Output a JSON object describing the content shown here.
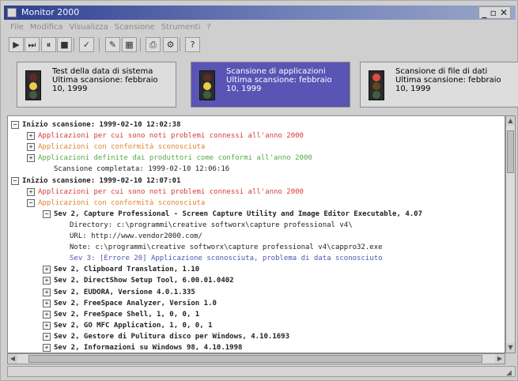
{
  "app": {
    "title": "Monitor 2000",
    "window_controls": "_|&#x2573;|x"
  },
  "menus": [
    "File",
    "Modifica",
    "Visualizza",
    "Scansione",
    "Strumenti",
    "?"
  ],
  "toolbar": {
    "buttons": [
      {
        "name": "play",
        "glyph": "▶"
      },
      {
        "name": "next",
        "glyph": "⏭"
      },
      {
        "name": "pause",
        "glyph": "⏸"
      },
      {
        "name": "stop",
        "glyph": "■"
      },
      {
        "name": "options",
        "glyph": "✓"
      },
      {
        "name": "edit",
        "glyph": "✎"
      },
      {
        "name": "report",
        "glyph": "▦"
      },
      {
        "name": "print",
        "glyph": "⎙"
      },
      {
        "name": "tools",
        "glyph": "⚙"
      },
      {
        "name": "help",
        "glyph": "?"
      }
    ]
  },
  "cards": [
    {
      "title": "Test della data di sistema",
      "line2": "Ultima scansione: febbraio",
      "line3": "10, 1999",
      "light": "amber"
    },
    {
      "title": "Scansione di applicazioni",
      "line2": "Ultima scansione: febbraio",
      "line3": "10, 1999",
      "light": "amber"
    },
    {
      "title": "Scansione di file di dati",
      "line2": "Ultima scansione: febbraio",
      "line3": "10, 1999",
      "light": "red"
    }
  ],
  "log": [
    {
      "indent": 0,
      "toggle": "−",
      "text": "Inizio scansione: 1999-02-10  12:02:38",
      "style": "bold"
    },
    {
      "indent": 1,
      "toggle": "+",
      "text": "Applicazioni per cui sono noti problemi connessi all'anno 2000",
      "style": "red"
    },
    {
      "indent": 1,
      "toggle": "+",
      "text": "Applicazioni con conformità sconosciuta",
      "style": "orange"
    },
    {
      "indent": 1,
      "toggle": "+",
      "text": "Applicazioni definite dai produttori come conformi all'anno 2000",
      "style": "green"
    },
    {
      "indent": 2,
      "toggle": "",
      "text": "Scansione completata: 1999-02-10  12:06:16",
      "style": "normal"
    },
    {
      "indent": 0,
      "toggle": "−",
      "text": "Inizio scansione: 1999-02-10  12:07:01",
      "style": "bold"
    },
    {
      "indent": 1,
      "toggle": "+",
      "text": "Applicazioni per cui sono noti problemi connessi all'anno 2000",
      "style": "red"
    },
    {
      "indent": 1,
      "toggle": "−",
      "text": "Applicazioni con conformità sconosciuta",
      "style": "orange"
    },
    {
      "indent": 2,
      "toggle": "−",
      "text": "Sev 2, Capture Professional - Screen Capture Utility and Image Editor Executable, 4.07",
      "style": "bold"
    },
    {
      "indent": 3,
      "toggle": "",
      "text": "Directory:     c:\\programmi\\creative softworx\\capture professional v4\\",
      "style": "normal"
    },
    {
      "indent": 3,
      "toggle": "",
      "text": "URL:           http://www.vendor2000.com/",
      "style": "normal"
    },
    {
      "indent": 3,
      "toggle": "",
      "text": "Note:          c:\\programmi\\creative softworx\\capture professional v4\\cappro32.exe",
      "style": "normal"
    },
    {
      "indent": 3,
      "toggle": "",
      "text": "Sev 3: [Errore 20] Applicazione sconosciuta, problema di data sconosciuto",
      "style": "blue"
    },
    {
      "indent": 2,
      "toggle": "+",
      "text": "Sev 2, Clipboard Translation, 1.10",
      "style": "bold"
    },
    {
      "indent": 2,
      "toggle": "+",
      "text": "Sev 2, DirectShow Setup Tool, 6.00.01.0402",
      "style": "bold"
    },
    {
      "indent": 2,
      "toggle": "+",
      "text": "Sev 2, EUDORA, Versione 4.0.1.335",
      "style": "bold"
    },
    {
      "indent": 2,
      "toggle": "+",
      "text": "Sev 2, FreeSpace Analyzer, Version 1.0",
      "style": "bold"
    },
    {
      "indent": 2,
      "toggle": "+",
      "text": "Sev 2, FreeSpace Shell, 1, 0, 0, 1",
      "style": "bold"
    },
    {
      "indent": 2,
      "toggle": "+",
      "text": "Sev 2, GO MFC Application, 1, 0, 0, 1",
      "style": "bold"
    },
    {
      "indent": 2,
      "toggle": "+",
      "text": "Sev 2, Gestore di Pulitura disco per Windows, 4.10.1693",
      "style": "bold"
    },
    {
      "indent": 2,
      "toggle": "+",
      "text": "Sev 2, Informazioni su Windows 98, 4.10.1998",
      "style": "bold"
    }
  ]
}
